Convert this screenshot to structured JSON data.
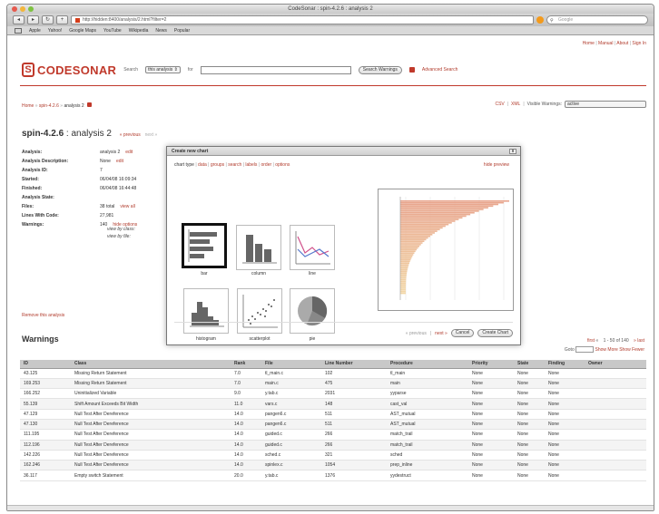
{
  "window": {
    "title": "CodeSonar : spin-4.2.6 : analysis 2"
  },
  "browser": {
    "url": "http://hidden:8400/analysis/2.html?filter=2",
    "search_placeholder": "Google",
    "bookmarks": [
      "Apple",
      "Yahoo!",
      "Google Maps",
      "YouTube",
      "Wikipedia",
      "News",
      "Popular"
    ]
  },
  "toplinks": {
    "home": "Home",
    "manual": "Manual",
    "about": "About",
    "signin": "Sign In"
  },
  "header": {
    "logo_text": "CODESONAR",
    "search_label": "Search",
    "scope_select": "this analysis",
    "for_label": "for",
    "search_button": "Search Warnings",
    "advanced_link": "Advanced Search"
  },
  "breadcrumb": {
    "home": "Home",
    "project": "spin-4.2.6",
    "current": "analysis 2"
  },
  "rightbar": {
    "csv": "CSV",
    "xml": "XML",
    "visible_label": "Visible Warnings:",
    "visible_value": "active"
  },
  "title": {
    "project": "spin-4.2.6",
    "sep": " : ",
    "analysis": "analysis 2",
    "prev": "« previous",
    "next": "next »"
  },
  "info": [
    {
      "k": "Analysis:",
      "v": "analysis 2",
      "link": "edit"
    },
    {
      "k": "Analysis Description:",
      "v": "None",
      "link": "edit"
    },
    {
      "k": "Analysis ID:",
      "v": "7",
      "link": ""
    },
    {
      "k": "Started:",
      "v": "06/04/08 16:09:34",
      "link": ""
    },
    {
      "k": "Finished:",
      "v": "06/04/08 16:44:48",
      "link": ""
    },
    {
      "k": "Analysis State:",
      "v": "",
      "link": ""
    },
    {
      "k": "Files:",
      "v": "38 total",
      "link": "view all"
    },
    {
      "k": "Lines With Code:",
      "v": "27,981",
      "link": ""
    },
    {
      "k": "Warnings:",
      "v": "140",
      "link": "hide options"
    }
  ],
  "views": {
    "by_class": "view by class:",
    "by_file": "view by file:"
  },
  "remove_link": "Remove this analysis",
  "warnings_heading": "Warnings",
  "pager": {
    "first": "first",
    "prev": "«",
    "range": "1 - 50 of 140",
    "next": "»",
    "last": "last",
    "goto_label": "Goto",
    "show_more": "Show More",
    "show_fewer": "Show Fewer"
  },
  "table": {
    "headers": [
      "ID",
      "Class",
      "Rank",
      "File",
      "Line Number",
      "Procedure",
      "Priority",
      "State",
      "Finding",
      "Owner"
    ],
    "rows": [
      [
        "43.125",
        "Missing Return Statement",
        "7.0",
        "tl_main.c",
        "102",
        "tl_main",
        "None",
        "None",
        "None",
        ""
      ],
      [
        "169.253",
        "Missing Return Statement",
        "7.0",
        "main.c",
        "475",
        "main",
        "None",
        "None",
        "None",
        ""
      ],
      [
        "166.252",
        "Uninitialized Variable",
        "9.0",
        "y.tab.c",
        "2031",
        "yyparse",
        "None",
        "None",
        "None",
        ""
      ],
      [
        "55.139",
        "Shift Amount Exceeds Bit Width",
        "11.0",
        "vars.c",
        "148",
        "cast_val",
        "None",
        "None",
        "None",
        ""
      ],
      [
        "47.129",
        "Null Test After Dereference",
        "14.0",
        "pangen6.c",
        "511",
        "AST_mutual",
        "None",
        "None",
        "None",
        ""
      ],
      [
        "47.130",
        "Null Test After Dereference",
        "14.0",
        "pangen6.c",
        "511",
        "AST_mutual",
        "None",
        "None",
        "None",
        ""
      ],
      [
        "111.195",
        "Null Test After Dereference",
        "14.0",
        "guided.c",
        "266",
        "match_trail",
        "None",
        "None",
        "None",
        ""
      ],
      [
        "112.196",
        "Null Test After Dereference",
        "14.0",
        "guided.c",
        "266",
        "match_trail",
        "None",
        "None",
        "None",
        ""
      ],
      [
        "142.226",
        "Null Test After Dereference",
        "14.0",
        "sched.c",
        "321",
        "sched",
        "None",
        "None",
        "None",
        ""
      ],
      [
        "162.246",
        "Null Test After Dereference",
        "14.0",
        "spinlex.c",
        "1054",
        "prep_inline",
        "None",
        "None",
        "None",
        ""
      ],
      [
        "36.117",
        "Empty switch Statement",
        "20.0",
        "y.tab.c",
        "1376",
        "yydestruct",
        "None",
        "None",
        "None",
        ""
      ]
    ]
  },
  "modal": {
    "title": "Create new chart",
    "close": "x",
    "tabs": [
      "chart type",
      "data",
      "groups",
      "search",
      "labels",
      "order",
      "options"
    ],
    "hide_preview": "hide preview",
    "chart_types": [
      "bar",
      "column",
      "line",
      "histogram",
      "scatterplot",
      "pie"
    ],
    "prev": "« previous",
    "next": "next »",
    "cancel": "Cancel",
    "create": "Create Chart"
  },
  "colors": {
    "brand": "#c0392b",
    "link": "#b13b2c",
    "preview_bar_start": "#e8a48c",
    "preview_bar_end": "#f2d7a6"
  }
}
